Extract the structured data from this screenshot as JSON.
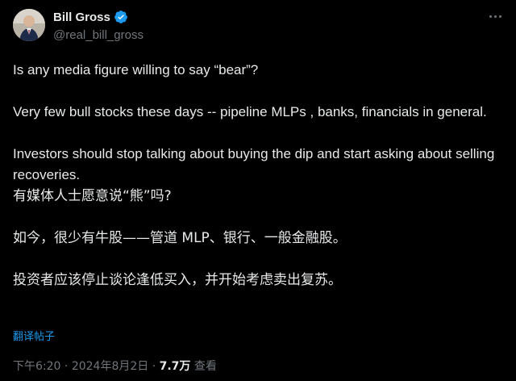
{
  "author": {
    "display_name": "Bill Gross",
    "handle": "@real_bill_gross",
    "verified": true
  },
  "tweet": {
    "paragraphs_en": [
      "Is any media figure willing to say “bear”?",
      "Very few bull stocks these days -- pipeline MLPs , banks, financials in general.",
      "Investors should stop talking about buying the dip and start asking about selling recoveries."
    ],
    "paragraphs_cn": [
      "有媒体人士愿意说“熊”吗?",
      "如今，很少有牛股——管道 MLP、银行、一般金融股。",
      "投资者应该停止谈论逢低买入，并开始考虑卖出复苏。"
    ]
  },
  "translate_label": "翻译帖子",
  "meta": {
    "time": "下午6:20",
    "separator": " · ",
    "date": "2024年8月2日",
    "views_count": "7.7万",
    "views_label": " 查看"
  },
  "colors": {
    "background": "#000000",
    "text": "#e7e9ea",
    "secondary": "#71767b",
    "accent": "#1d9bf0"
  },
  "icons": [
    "verified-badge-icon",
    "more-options-icon"
  ]
}
